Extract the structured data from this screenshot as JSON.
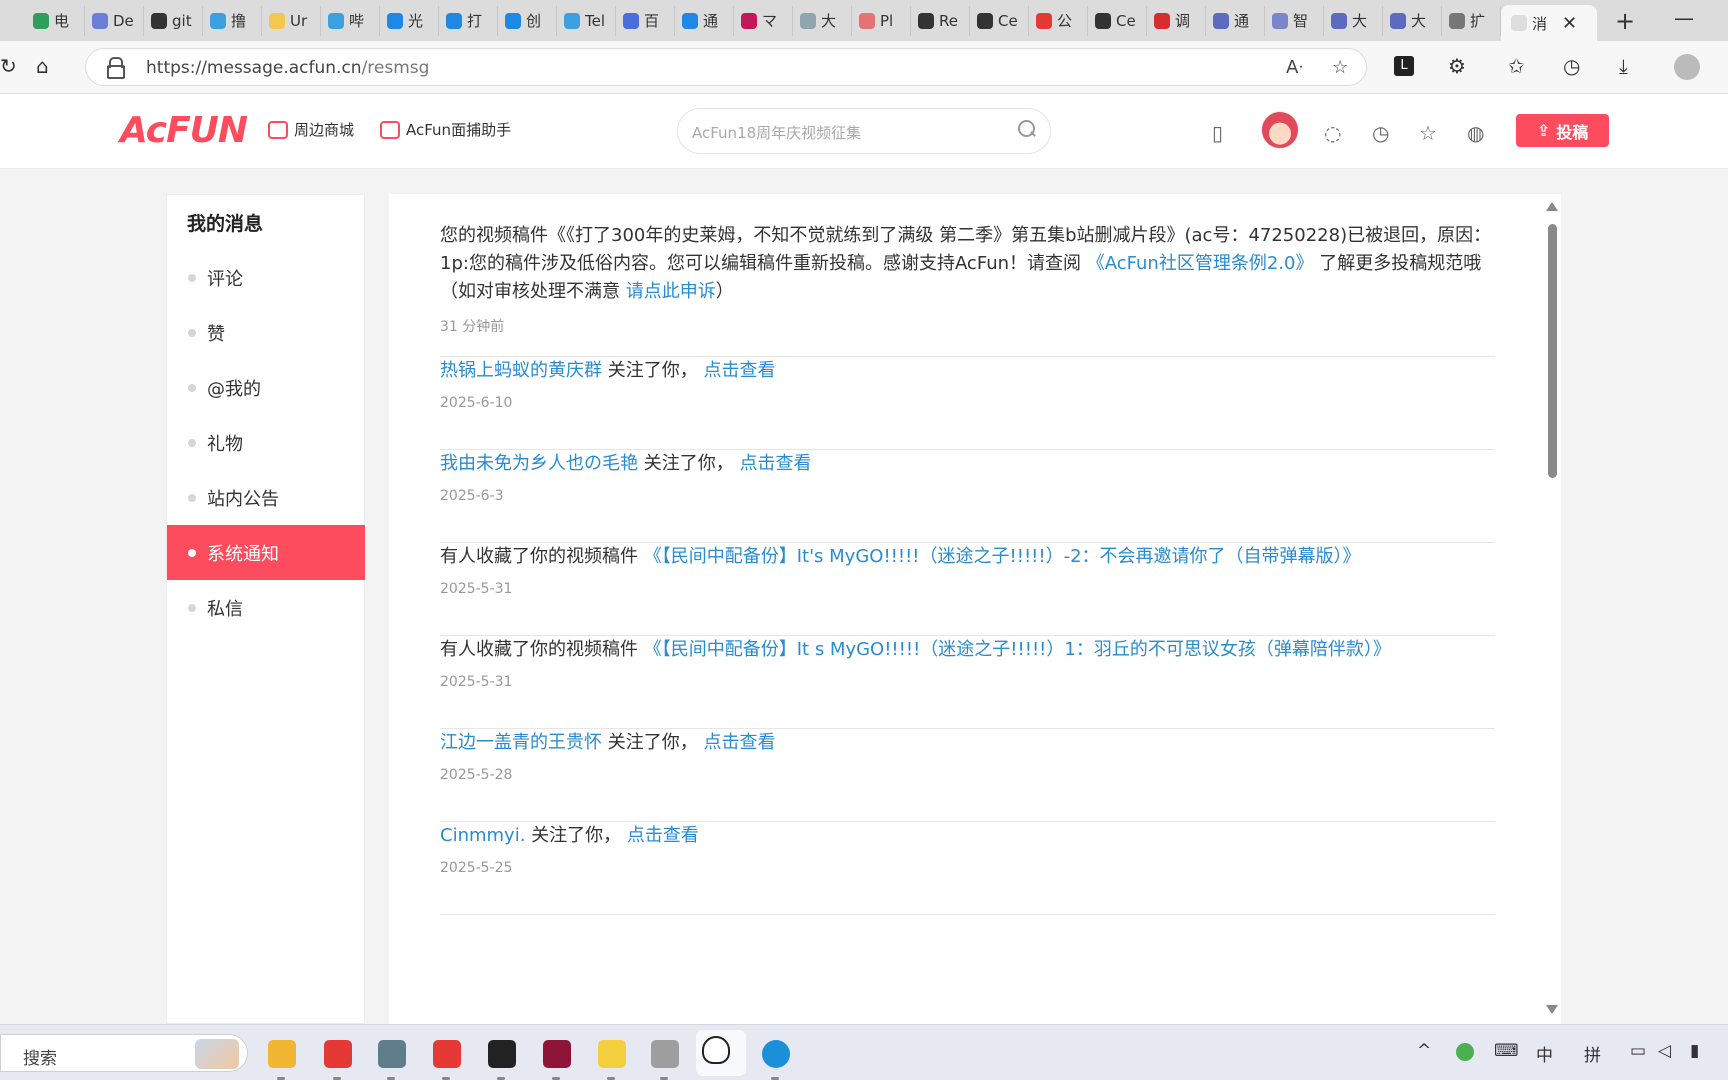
{
  "browser": {
    "tabs": [
      {
        "label": "电",
        "color": "#2e9e5b"
      },
      {
        "label": "De",
        "color": "#6c7fd8"
      },
      {
        "label": "git",
        "color": "#333333"
      },
      {
        "label": "撸",
        "color": "#3aa0e0"
      },
      {
        "label": "Ur",
        "color": "#f2c94c"
      },
      {
        "label": "哔",
        "color": "#3aa0e0"
      },
      {
        "label": "光",
        "color": "#1e88e5"
      },
      {
        "label": "打",
        "color": "#1e88e5"
      },
      {
        "label": "创",
        "color": "#1e88e5"
      },
      {
        "label": "Tel",
        "color": "#3aa0e0"
      },
      {
        "label": "百",
        "color": "#4a6ee0"
      },
      {
        "label": "通",
        "color": "#1e88e5"
      },
      {
        "label": "マ",
        "color": "#c2185b"
      },
      {
        "label": "大",
        "color": "#90a4ae"
      },
      {
        "label": "Pl",
        "color": "#e57373"
      },
      {
        "label": "Re",
        "color": "#333333"
      },
      {
        "label": "Ce",
        "color": "#333333"
      },
      {
        "label": "公",
        "color": "#e53935"
      },
      {
        "label": "Ce",
        "color": "#333333"
      },
      {
        "label": "调",
        "color": "#d32f2f"
      },
      {
        "label": "通",
        "color": "#5c6bc0"
      },
      {
        "label": "智",
        "color": "#7986cb"
      },
      {
        "label": "大",
        "color": "#5c6bc0"
      },
      {
        "label": "大",
        "color": "#5c6bc0"
      },
      {
        "label": "扩",
        "color": "#777777"
      }
    ],
    "active_tab": "消",
    "url_host": "https://message.acfun.cn",
    "url_path": "/resmsg"
  },
  "header": {
    "logo": "AcFUN",
    "nav": [
      {
        "label": "周边商城"
      },
      {
        "label": "AcFun面捕助手"
      }
    ],
    "search_placeholder": "AcFun18周年庆视频征集",
    "upload_label": "投稿"
  },
  "sidebar": {
    "title": "我的消息",
    "items": [
      {
        "label": "评论",
        "active": false
      },
      {
        "label": "赞",
        "active": false
      },
      {
        "label": "@我的",
        "active": false
      },
      {
        "label": "礼物",
        "active": false
      },
      {
        "label": "站内公告",
        "active": false
      },
      {
        "label": "系统通知",
        "active": true
      },
      {
        "label": "私信",
        "active": false
      }
    ]
  },
  "messages": [
    {
      "parts": [
        {
          "t": "您的视频稿件《《打了300年的史莱姆，不知不觉就练到了满级 第二季》第五集b站删减片段》(ac号：47250228)已被退回，原因：1p:您的稿件涉及低俗内容。您可以编辑稿件重新投稿。感谢支持AcFun！请查阅 "
        },
        {
          "t": "《AcFun社区管理条例2.0》",
          "link": true
        },
        {
          "t": " 了解更多投稿规范哦（如对审核处理不满意 "
        },
        {
          "t": "请点此申诉",
          "link": true
        },
        {
          "t": "）"
        }
      ],
      "time": "31 分钟前"
    },
    {
      "parts": [
        {
          "t": "热锅上蚂蚁的黄庆群",
          "link": true
        },
        {
          "t": " 关注了你，  "
        },
        {
          "t": "点击查看",
          "link": true
        }
      ],
      "time": "2025-6-10"
    },
    {
      "parts": [
        {
          "t": "我由未免为乡人也の毛艳",
          "link": true
        },
        {
          "t": " 关注了你，  "
        },
        {
          "t": "点击查看",
          "link": true
        }
      ],
      "time": "2025-6-3"
    },
    {
      "parts": [
        {
          "t": "有人收藏了你的视频稿件 "
        },
        {
          "t": "《【民间中配备份】It's MyGO!!!!!（迷途之子!!!!!）-2：不会再邀请你了（自带弹幕版）》",
          "link": true
        }
      ],
      "time": "2025-5-31"
    },
    {
      "parts": [
        {
          "t": "有人收藏了你的视频稿件 "
        },
        {
          "t": "《【民间中配备份】It s MyGO!!!!!（迷途之子!!!!!）1：羽丘的不可思议女孩（弹幕陪伴款）》",
          "link": true
        }
      ],
      "time": "2025-5-31"
    },
    {
      "parts": [
        {
          "t": "江边一盖青的王贵怀",
          "link": true
        },
        {
          "t": " 关注了你，  "
        },
        {
          "t": "点击查看",
          "link": true
        }
      ],
      "time": "2025-5-28"
    },
    {
      "parts": [
        {
          "t": "Cinmmyi.",
          "link": true
        },
        {
          "t": " 关注了你，  "
        },
        {
          "t": "点击查看",
          "link": true
        }
      ],
      "time": "2025-5-25"
    }
  ],
  "taskbar": {
    "search_label": "搜索",
    "apps": [
      {
        "name": "file-explorer-app",
        "color": "#f2b632"
      },
      {
        "name": "paper-plane-app",
        "color": "#e53935"
      },
      {
        "name": "settings-app",
        "color": "#607d8b"
      },
      {
        "name": "store-app",
        "color": "#e53935"
      },
      {
        "name": "music-app",
        "color": "#222222"
      },
      {
        "name": "game-app",
        "color": "#8e1538"
      },
      {
        "name": "player-app",
        "color": "#f4d03f"
      },
      {
        "name": "tablet-app",
        "color": "#9e9e9e"
      },
      {
        "name": "qq-app",
        "color": "#ffffff"
      },
      {
        "name": "edge-app",
        "color": "#1b8fd8"
      }
    ],
    "tray_ime_lang": "中",
    "tray_ime_mode": "拼"
  }
}
